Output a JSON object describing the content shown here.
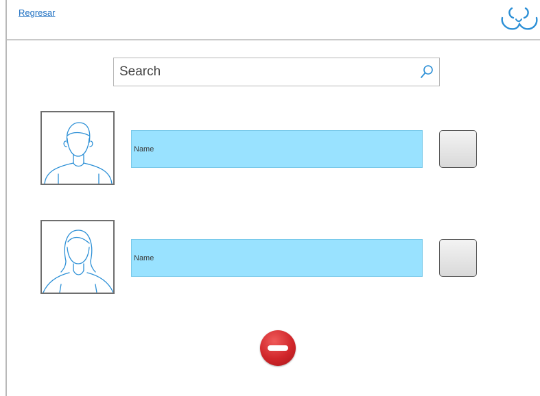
{
  "header": {
    "back_label": "Regresar",
    "logo_icon": "headset-logo-icon"
  },
  "search": {
    "placeholder": "Search",
    "value": "",
    "icon": "search-icon"
  },
  "users": [
    {
      "avatar_icon": "male-avatar-icon",
      "name_placeholder": "Name"
    },
    {
      "avatar_icon": "female-avatar-icon",
      "name_placeholder": "Name"
    }
  ],
  "actions": {
    "remove_icon": "minus-circle-icon"
  },
  "colors": {
    "link": "#1d6fc2",
    "icon_blue": "#2b8fd6",
    "name_field_bg": "#99e2ff",
    "remove_red": "#d0262a"
  }
}
